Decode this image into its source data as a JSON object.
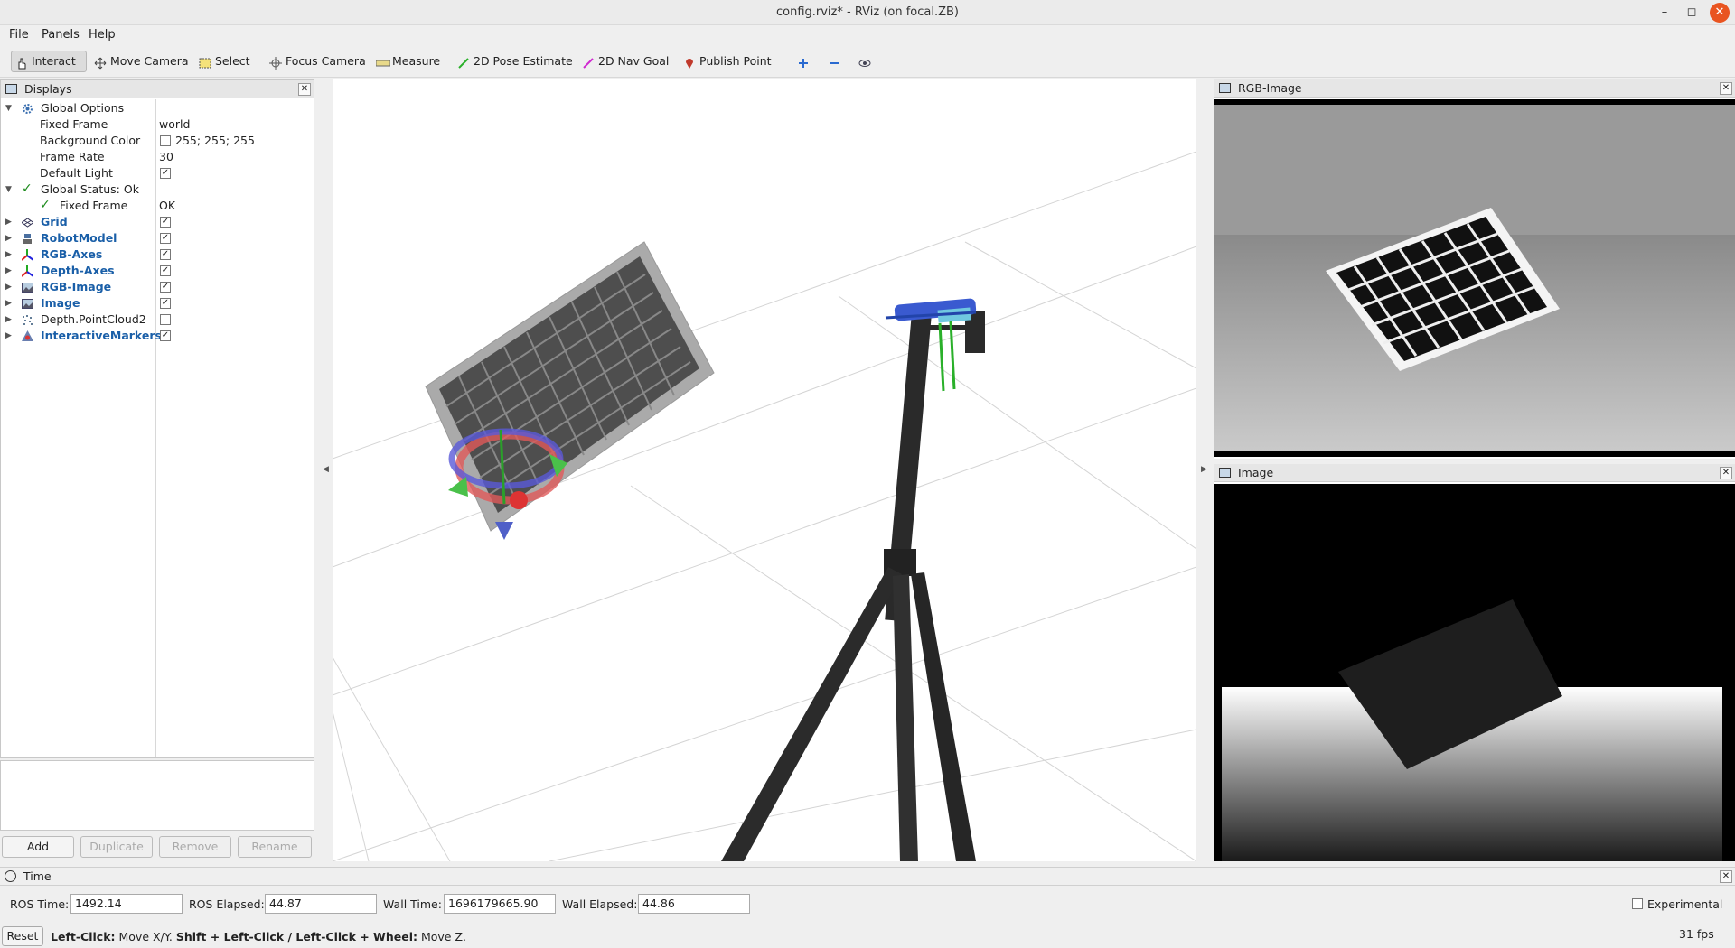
{
  "window": {
    "title": "config.rviz* - RViz (on focal.ZB)"
  },
  "menu": [
    "File",
    "Panels",
    "Help"
  ],
  "toolbar": {
    "tools": [
      "Interact",
      "Move Camera",
      "Select",
      "Focus Camera",
      "Measure",
      "2D Pose Estimate",
      "2D Nav Goal",
      "Publish Point"
    ],
    "active": "Interact"
  },
  "displays": {
    "title": "Displays",
    "rows": [
      {
        "label": "Global Options",
        "value": ""
      },
      {
        "label": "Fixed Frame",
        "value": "world"
      },
      {
        "label": "Background Color",
        "value": "255; 255; 255"
      },
      {
        "label": "Frame Rate",
        "value": "30"
      },
      {
        "label": "Default Light",
        "value": ""
      },
      {
        "label": "Global Status: Ok",
        "value": ""
      },
      {
        "label": "Fixed Frame",
        "value": "OK"
      },
      {
        "label": "Grid",
        "value": ""
      },
      {
        "label": "RobotModel",
        "value": ""
      },
      {
        "label": "RGB-Axes",
        "value": ""
      },
      {
        "label": "Depth-Axes",
        "value": ""
      },
      {
        "label": "RGB-Image",
        "value": ""
      },
      {
        "label": "Image",
        "value": ""
      },
      {
        "label": "Depth.PointCloud2",
        "value": ""
      },
      {
        "label": "InteractiveMarkers",
        "value": ""
      }
    ],
    "checked": {
      "default_light": true,
      "grid": true,
      "robotmodel": true,
      "rgb_axes": true,
      "depth_axes": true,
      "rgb_image": true,
      "image": true,
      "depth_pointcloud2": false,
      "interactivemarkers": true
    },
    "buttons": [
      "Add",
      "Duplicate",
      "Remove",
      "Rename"
    ]
  },
  "panels": {
    "rgb_image": "RGB-Image",
    "image": "Image"
  },
  "time": {
    "title": "Time",
    "ros_time_label": "ROS Time:",
    "ros_time": "1492.14",
    "ros_elapsed_label": "ROS Elapsed:",
    "ros_elapsed": "44.87",
    "wall_time_label": "Wall Time:",
    "wall_time": "1696179665.90",
    "wall_elapsed_label": "Wall Elapsed:",
    "wall_elapsed": "44.86",
    "experimental": "Experimental"
  },
  "status": {
    "reset": "Reset",
    "hint_b1": "Left-Click:",
    "hint_t1": " Move X/Y. ",
    "hint_b2": "Shift + Left-Click / Left-Click + Wheel:",
    "hint_t2": " Move Z.",
    "fps": "31 fps"
  }
}
